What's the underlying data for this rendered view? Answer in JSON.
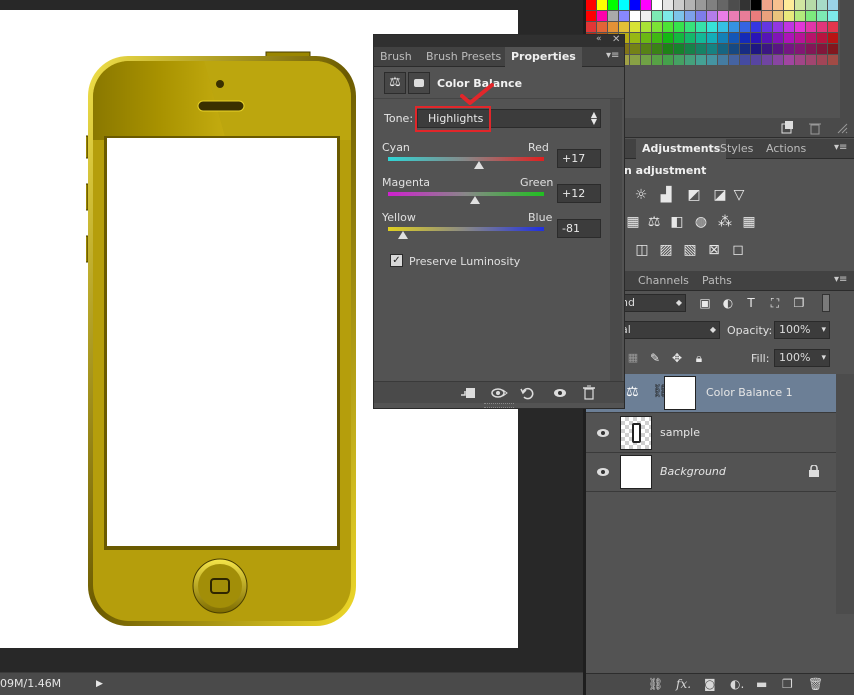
{
  "status": {
    "doc_size": "09M/1.46M",
    "arrow": "▶"
  },
  "properties": {
    "tabs": [
      "Brush",
      "Brush Presets",
      "Properties"
    ],
    "title": "Color Balance",
    "tone_label": "Tone:",
    "tone_value": "Highlights",
    "sliders": [
      {
        "left": "Cyan",
        "right": "Red",
        "value": 17,
        "display": "+17"
      },
      {
        "left": "Magenta",
        "right": "Green",
        "value": 12,
        "display": "+12"
      },
      {
        "left": "Yellow",
        "right": "Blue",
        "value": -81,
        "display": "-81"
      }
    ],
    "preserve_label": "Preserve Luminosity",
    "preserve_checked": true,
    "annotation_color": "#e2262a"
  },
  "adjustments": {
    "tabs": [
      "y",
      "Adjustments",
      "Styles",
      "Actions"
    ],
    "heading": "n adjustment"
  },
  "layers": {
    "tabs": [
      "Channels",
      "Paths"
    ],
    "filter_value": "nd",
    "blend_value": "al",
    "opacity_label": "Opacity:",
    "opacity_value": "100%",
    "fill_label": "Fill:",
    "fill_value": "100%",
    "rows": [
      {
        "name": "Color Balance 1",
        "selected": true
      },
      {
        "name": "sample",
        "selected": false
      },
      {
        "name": "Background",
        "selected": false,
        "italic": true,
        "locked": true
      }
    ]
  },
  "colors": {
    "phone_gold": "#b59e0c",
    "selection_blue": "#6c7f96",
    "panel_gray": "#535353"
  }
}
